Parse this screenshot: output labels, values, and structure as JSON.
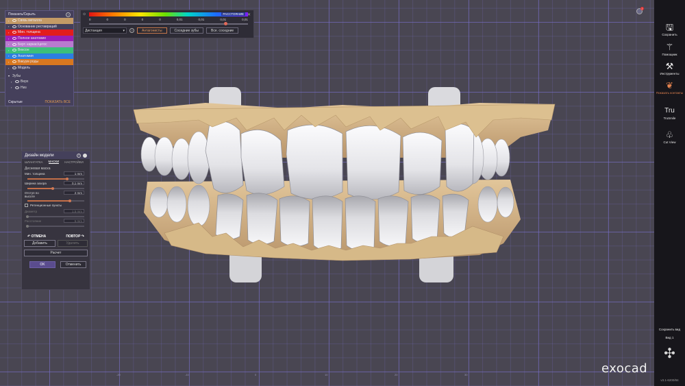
{
  "show_hide": {
    "title": "Показать/Скрыть",
    "help": "?",
    "layers": [
      {
        "label": "Связь металла",
        "color": "#c49a66",
        "expanded": false
      },
      {
        "label": "Основание реставраций",
        "color": "#45405b",
        "expanded": false
      },
      {
        "label": "Мин. толщина",
        "color": "#e21d1d",
        "expanded": false
      },
      {
        "label": "Полное анатомие",
        "color": "#9b1fb5",
        "expanded": false
      },
      {
        "label": "Берт. каркас/цегос",
        "color": "#b87bcf",
        "expanded": false
      },
      {
        "label": "Вексон",
        "color": "#3bbf7a",
        "expanded": false
      },
      {
        "label": "Анатомия",
        "color": "#2c7fe0",
        "expanded": false
      },
      {
        "label": "Вакуум роды",
        "color": "#d8771f",
        "expanded": false
      },
      {
        "label": "Модель",
        "color": "#45405b",
        "expanded": false
      }
    ],
    "teeth_group": "Зубы",
    "teeth_items": [
      "Верх",
      "Низ"
    ],
    "hidden_label": "Скрытые",
    "show_all": "ПОКАЗАТЬ ВСЕ"
  },
  "distance_bar": {
    "legend_tag": "РАССТОЯНИЕ",
    "ticks": [
      "0",
      "0",
      "0",
      "0",
      "0",
      "0,01",
      "0,01",
      "0,01",
      "0,01"
    ],
    "mode_select": "Дистанция",
    "help": "?",
    "buttons": [
      {
        "label": "Антагонисты",
        "active": true
      },
      {
        "label": "Соседние зубы",
        "active": false
      },
      {
        "label": "Все. соседние",
        "active": false
      }
    ],
    "slider_fraction": 0.86
  },
  "design_panel": {
    "title": "Дизайн модели",
    "tabs": [
      "ШЛАНГАТКА",
      "МАСКИ",
      "НАСТРОЙКИ"
    ],
    "active_tab": 1,
    "section": "Десневая маска",
    "params": [
      {
        "label": "Мин. толщина",
        "value": "1 mm",
        "fraction": 0.7
      },
      {
        "label": "Ширина зазора",
        "value": "0,1 mm",
        "fraction": 0.45
      },
      {
        "label": "Отступ по высоте",
        "value": "2 mm",
        "fraction": 0.75
      }
    ],
    "retention_label": "Ретенционные пункты",
    "disabled_params": [
      {
        "label": "Диаметр",
        "value": "1,5 mm"
      },
      {
        "label": "Расстояние",
        "value": "5 mm"
      }
    ],
    "undo": "ОТМЕНА",
    "redo": "ПОВТОР",
    "add": "Добавить",
    "delete": "Удалить",
    "calculate": "Расчет",
    "ok": "OK",
    "cancel": "Отменить"
  },
  "sidebar": {
    "tools": [
      {
        "label": "Сохранить",
        "icon": "save-icon"
      },
      {
        "label": "Помощник",
        "icon": "wizard-wand-icon"
      },
      {
        "label": "Инструменты",
        "icon": "tools-icon"
      },
      {
        "label": "Показать контакты",
        "icon": "contacts-tooth-icon"
      },
      {
        "label": "TruSmile",
        "icon": "trusmile-icon"
      },
      {
        "label": "Cut View",
        "icon": "cut-view-tooth-icon"
      }
    ],
    "save_view": "Сохранить вид",
    "view_name": "Вид 1",
    "version": "v3.1-6200/84"
  },
  "notification_count": "2",
  "brand": "exocad",
  "colors": {
    "accent": "#e4834f",
    "panel": "#45405b",
    "gingiva": "#d8b98a",
    "teeth": "#e9e9ec"
  }
}
